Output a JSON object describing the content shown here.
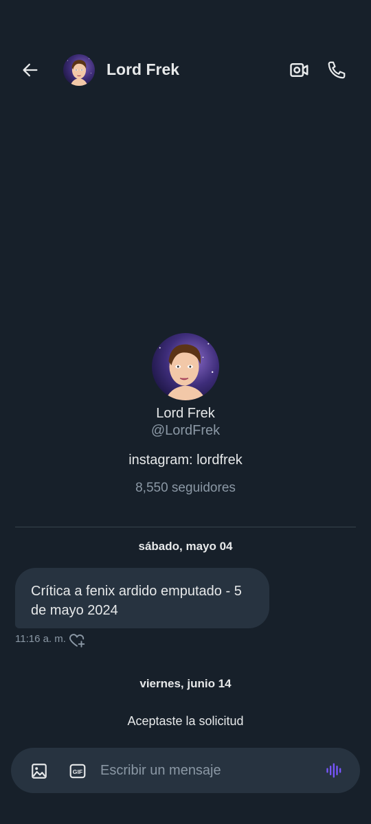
{
  "header": {
    "contact_name": "Lord Frek",
    "icons": [
      "back-arrow-icon",
      "video-camera-icon",
      "phone-icon"
    ]
  },
  "profile": {
    "name": "Lord Frek",
    "handle": "@LordFrek",
    "bio": "instagram: lordfrek",
    "followers": "8,550 seguidores"
  },
  "conversation": {
    "date_1": "sábado, mayo 04",
    "message_text": "Crítica a fenix ardido emputado - 5 de mayo 2024",
    "message_time": "11:16 a. m.",
    "date_2": "viernes, junio 14",
    "system_message": "Aceptaste la solicitud"
  },
  "composer": {
    "placeholder": "Escribir un mensaje",
    "icons": [
      "image-icon",
      "gif-icon",
      "voice-icon"
    ]
  },
  "colors": {
    "background": "#17202a",
    "bubble": "#273340",
    "text_primary": "#e7e9ea",
    "text_secondary": "#8b98a5",
    "accent_voice": "#7856ff"
  }
}
